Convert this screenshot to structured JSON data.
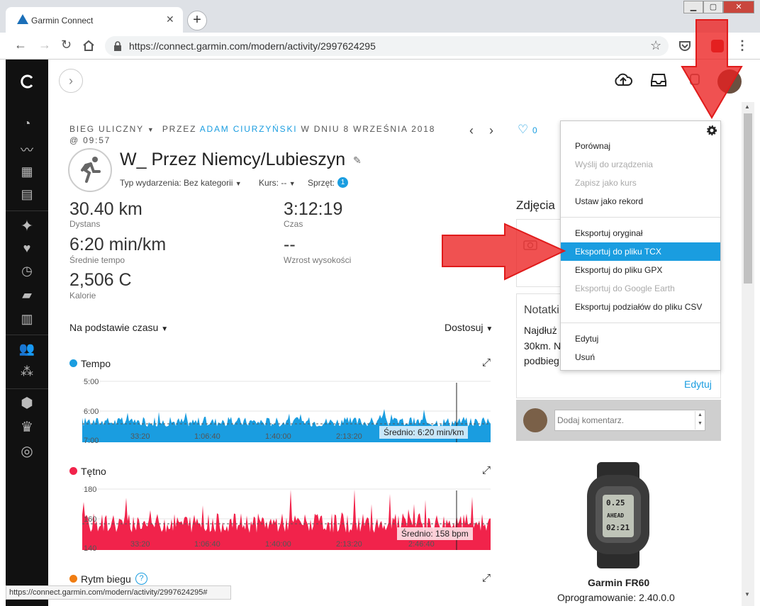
{
  "browser": {
    "tab_title": "Garmin Connect",
    "url": "https://connect.garmin.com/modern/activity/2997624295",
    "status_url": "https://connect.garmin.com/modern/activity/2997624295#"
  },
  "activity": {
    "breadcrumb_type": "BIEG ULICZNY",
    "breadcrumb_by": "PRZEZ",
    "breadcrumb_author": "ADAM CIURZYŃSKI",
    "breadcrumb_date": "W DNIU 8 WRZEŚNIA 2018 @",
    "breadcrumb_time": "09:57",
    "likes": "0",
    "title": "W_ Przez Niemcy/Lubieszyn",
    "event_type": "Typ wydarzenia: Bez kategorii",
    "course": "Kurs: --",
    "gear": "Sprzęt:",
    "gear_count": "1"
  },
  "stats": [
    {
      "value": "30.40 km",
      "label": "Dystans"
    },
    {
      "value": "3:12:19",
      "label": "Czas"
    },
    {
      "value": "6:20 min/km",
      "label": "Średnie tempo"
    },
    {
      "value": "--",
      "label": "Wzrost wysokości"
    },
    {
      "value": "2,506 C",
      "label": "Kalorie"
    }
  ],
  "charts_header": {
    "basis": "Na podstawie czasu",
    "customize": "Dostosuj"
  },
  "charts": [
    {
      "title": "Tempo",
      "color": "#1a9de0",
      "y_ticks": [
        "5:00",
        "6:00",
        "7:00"
      ],
      "x_ticks": [
        "33:20",
        "1:06:40",
        "1:40:00",
        "2:13:20",
        "2:46:40"
      ],
      "average": "Średnio: 6:20 min/km"
    },
    {
      "title": "Tętno",
      "color": "#f1234b",
      "y_ticks": [
        "180",
        "160",
        "140"
      ],
      "x_ticks": [
        "33:20",
        "1:06:40",
        "1:40:00",
        "2:13:20",
        "2:46:40"
      ],
      "average": "Średnio: 158 bpm"
    },
    {
      "title": "Rytm biegu",
      "color": "#f07d12"
    }
  ],
  "right_panel": {
    "photos_title": "Zdjęcia",
    "notes_title": "Notatki",
    "notes_text": [
      "Najdłuż",
      "30km. N",
      "podbieg"
    ],
    "edit_link": "Edytuj",
    "comment_placeholder": "Dodaj komentarz.",
    "device_name": "Garmin FR60",
    "device_firmware": "Oprogramowanie: 2.40.0.0"
  },
  "menu": {
    "group1": [
      {
        "label": "Porównaj",
        "disabled": false
      },
      {
        "label": "Wyślij do urządzenia",
        "disabled": true
      },
      {
        "label": "Zapisz jako kurs",
        "disabled": true
      },
      {
        "label": "Ustaw jako rekord",
        "disabled": false
      }
    ],
    "group2": [
      {
        "label": "Eksportuj oryginał",
        "disabled": false
      },
      {
        "label": "Eksportuj do pliku TCX",
        "disabled": false,
        "highlighted": true
      },
      {
        "label": "Eksportuj do pliku GPX",
        "disabled": false
      },
      {
        "label": "Eksportuj do Google Earth",
        "disabled": true
      },
      {
        "label": "Eksportuj podziałów do pliku CSV",
        "disabled": false
      }
    ],
    "group3": [
      {
        "label": "Edytuj",
        "disabled": false
      },
      {
        "label": "Usuń",
        "disabled": false
      }
    ],
    "highlight_color": "#1a9de0"
  },
  "watch_screen": [
    "0.25",
    "AHEAD",
    "02:21"
  ]
}
